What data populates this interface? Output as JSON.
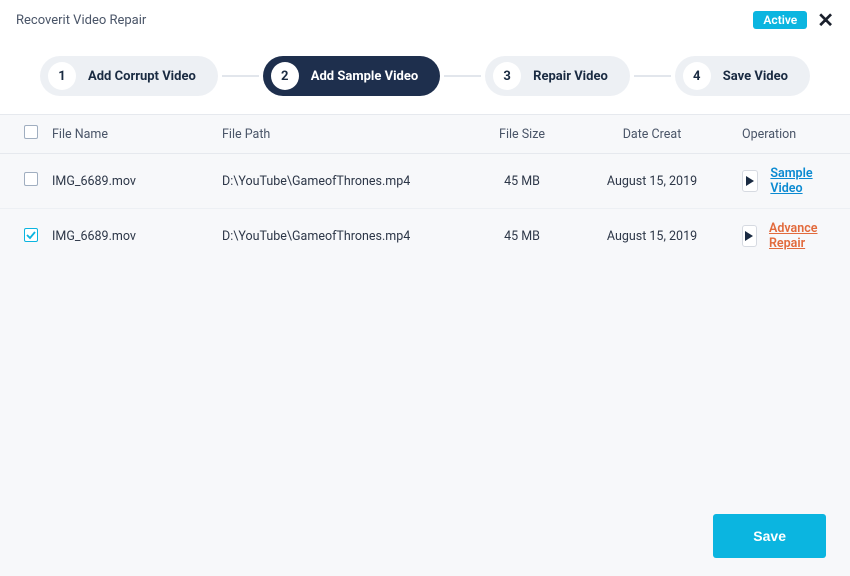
{
  "header": {
    "title": "Recoverit Video Repair",
    "badge": "Active"
  },
  "steps": [
    {
      "num": "1",
      "label": "Add Corrupt Video"
    },
    {
      "num": "2",
      "label": "Add Sample Video"
    },
    {
      "num": "3",
      "label": "Repair Video"
    },
    {
      "num": "4",
      "label": "Save Video"
    }
  ],
  "active_step_index": 1,
  "table": {
    "headers": {
      "filename": "File Name",
      "filepath": "File Path",
      "filesize": "File Size",
      "date": "Date Creat",
      "operation": "Operation"
    },
    "rows": [
      {
        "checked": false,
        "name": "IMG_6689.mov",
        "path": "D:\\YouTube\\GameofThrones.mp4",
        "size": "45 MB",
        "date": "August 15, 2019",
        "op_label": "Sample Video",
        "op_class": "sample"
      },
      {
        "checked": true,
        "name": "IMG_6689.mov",
        "path": "D:\\YouTube\\GameofThrones.mp4",
        "size": "45 MB",
        "date": "August 15, 2019",
        "op_label": "Advance Repair",
        "op_class": "advance"
      }
    ]
  },
  "footer": {
    "save_label": "Save"
  }
}
